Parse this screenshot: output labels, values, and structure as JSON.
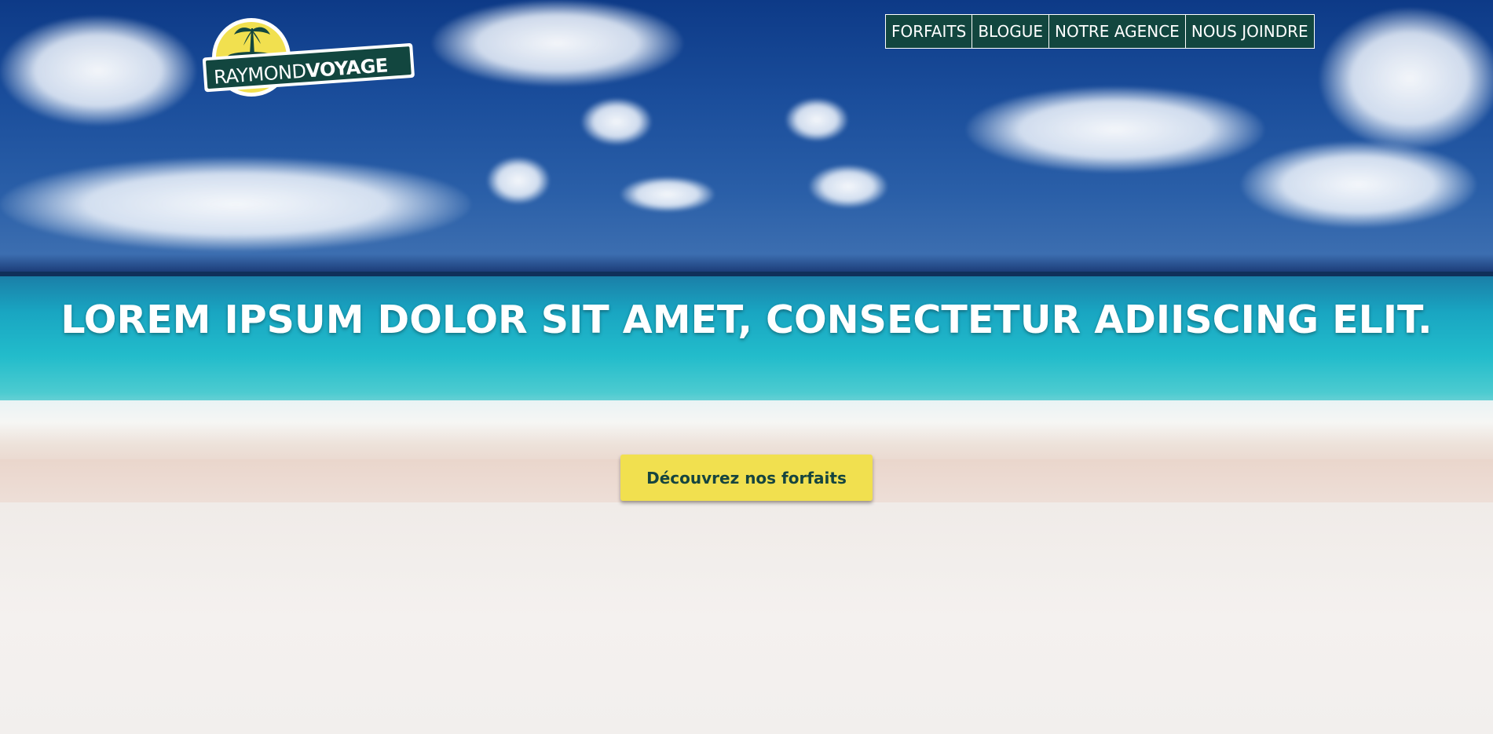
{
  "logo": {
    "text_light": "RAYMOND",
    "text_bold": "VOYAGE"
  },
  "nav": {
    "items": [
      {
        "label": "FORFAITS"
      },
      {
        "label": "BLOGUE"
      },
      {
        "label": "NOTRE AGENCE"
      },
      {
        "label": "NOUS JOINDRE"
      }
    ]
  },
  "hero": {
    "headline": "LOREM IPSUM DOLOR SIT AMET, CONSECTETUR ADIISCING ELIT.",
    "cta_label": "Découvrez nos forfaits"
  },
  "colors": {
    "brand_dark": "#12463f",
    "accent_yellow": "#f1e04f",
    "text_white": "#ffffff"
  }
}
